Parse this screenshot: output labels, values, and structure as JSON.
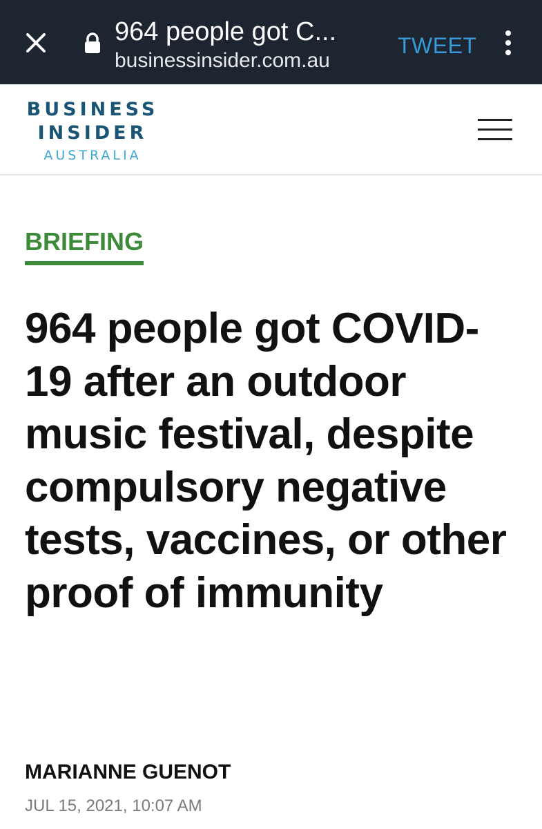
{
  "browser": {
    "page_title": "964 people got C...",
    "domain": "businessinsider.com.au",
    "tweet_label": "TWEET",
    "icons": {
      "close": "close-icon",
      "lock": "lock-icon",
      "menu": "more-vertical-icon"
    }
  },
  "site": {
    "logo_line1": "BUSINESS",
    "logo_line2": "INSIDER",
    "logo_line3": "AUSTRALIA",
    "menu_icon": "hamburger-menu-icon"
  },
  "article": {
    "section": "BRIEFING",
    "headline": "964 people got COVID-19 after an outdoor music festival, despite compulsory negative tests, vaccines, or other proof of immunity",
    "author": "MARIANNE GUENOT",
    "date": "JUL 15, 2021, 10:07 AM"
  },
  "colors": {
    "topbar_bg": "#1d2530",
    "tweet_blue": "#3a9ad9",
    "logo_navy": "#1a5576",
    "logo_light_blue": "#3fa7d6",
    "section_green": "#3d8b3a",
    "date_gray": "#7a7a7a"
  }
}
